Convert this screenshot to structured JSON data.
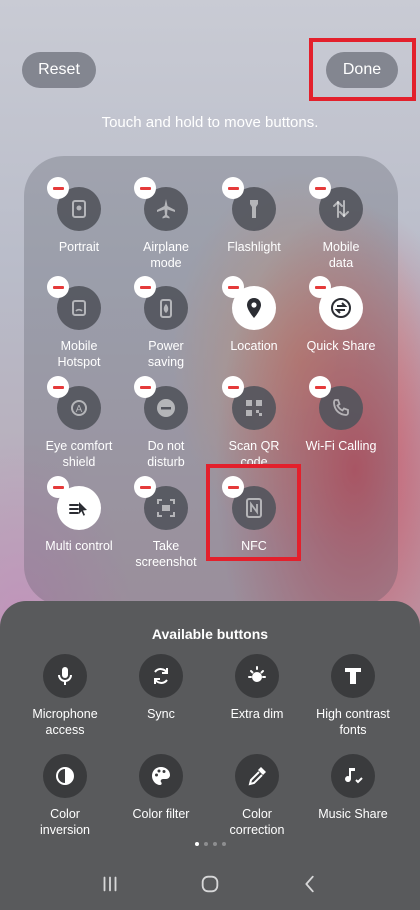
{
  "header": {
    "reset_label": "Reset",
    "done_label": "Done",
    "hint": "Touch and hold to move buttons."
  },
  "active_tiles": [
    {
      "label": "Portrait",
      "icon": "portrait-icon",
      "on": false
    },
    {
      "label": "Airplane\nmode",
      "icon": "airplane-icon",
      "on": false
    },
    {
      "label": "Flashlight",
      "icon": "flashlight-icon",
      "on": false
    },
    {
      "label": "Mobile\ndata",
      "icon": "mobile-data-icon",
      "on": false
    },
    {
      "label": "Mobile\nHotspot",
      "icon": "hotspot-icon",
      "on": false
    },
    {
      "label": "Power\nsaving",
      "icon": "power-saving-icon",
      "on": false
    },
    {
      "label": "Location",
      "icon": "location-icon",
      "on": true
    },
    {
      "label": "Quick Share",
      "icon": "quick-share-icon",
      "on": true
    },
    {
      "label": "Eye comfort\nshield",
      "icon": "eye-comfort-icon",
      "on": false
    },
    {
      "label": "Do not\ndisturb",
      "icon": "do-not-disturb-icon",
      "on": false
    },
    {
      "label": "Scan QR\ncode",
      "icon": "qr-icon",
      "on": false
    },
    {
      "label": "Wi-Fi Calling",
      "icon": "wifi-calling-icon",
      "on": false
    },
    {
      "label": "Multi control",
      "icon": "multi-control-icon",
      "on": true
    },
    {
      "label": "Take\nscreenshot",
      "icon": "screenshot-icon",
      "on": false
    },
    {
      "label": "NFC",
      "icon": "nfc-icon",
      "on": false
    }
  ],
  "available": {
    "title": "Available buttons",
    "tiles": [
      {
        "label": "Microphone\naccess",
        "icon": "microphone-icon"
      },
      {
        "label": "Sync",
        "icon": "sync-icon"
      },
      {
        "label": "Extra dim",
        "icon": "extra-dim-icon"
      },
      {
        "label": "High contrast\nfonts",
        "icon": "high-contrast-fonts-icon"
      },
      {
        "label": "Color\ninversion",
        "icon": "color-inversion-icon"
      },
      {
        "label": "Color filter",
        "icon": "color-filter-icon"
      },
      {
        "label": "Color\ncorrection",
        "icon": "color-correction-icon"
      },
      {
        "label": "Music Share",
        "icon": "music-share-icon"
      }
    ],
    "page_count": 4,
    "active_page": 1
  },
  "colors": {
    "highlight": "#e3202c",
    "remove_badge": "#e53a3a"
  }
}
